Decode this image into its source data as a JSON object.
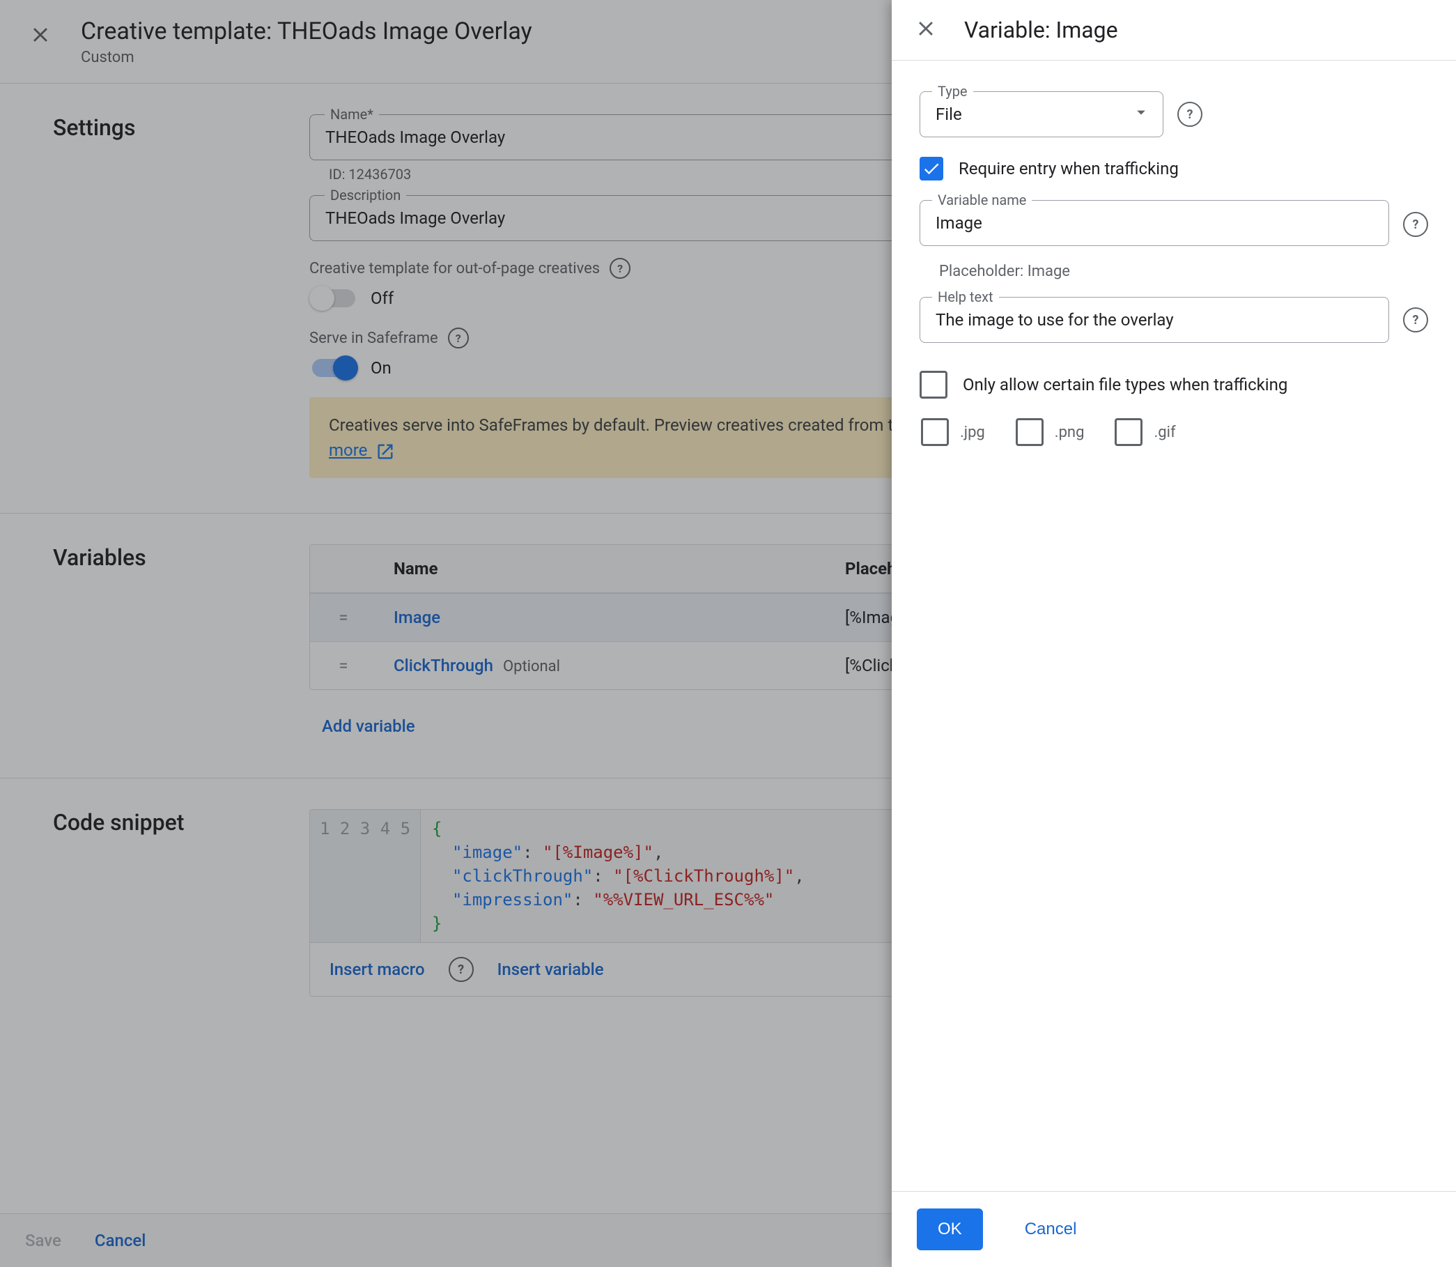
{
  "header": {
    "title": "Creative template: THEOads Image Overlay",
    "subtitle": "Custom"
  },
  "settings": {
    "section_label": "Settings",
    "name_label": "Name*",
    "name_value": "THEOads Image Overlay",
    "id_text": "ID: 12436703",
    "desc_label": "Description",
    "desc_value": "THEOads Image Overlay",
    "out_of_page_label": "Creative template for out-of-page creatives",
    "out_of_page_state": "Off",
    "safeframe_label": "Serve in Safeframe",
    "safeframe_state": "On",
    "info_text": "Creatives serve into SafeFrames by default. Preview creatives created from this template to ensure they're compatible with SafeFrames. ",
    "info_link": "Learn more"
  },
  "variables": {
    "section_label": "Variables",
    "col_name": "Name",
    "col_placeholder": "Placeholder",
    "rows": [
      {
        "name": "Image",
        "optional": "",
        "placeholder": "[%Image%]"
      },
      {
        "name": "ClickThrough",
        "optional": "Optional",
        "placeholder": "[%ClickThrough%]"
      }
    ],
    "add_label": "Add variable"
  },
  "code": {
    "section_label": "Code snippet",
    "line_count": 5,
    "kv": [
      {
        "key": "\"image\"",
        "val": "\"[%Image%]\"",
        "comma": ","
      },
      {
        "key": "\"clickThrough\"",
        "val": "\"[%ClickThrough%]\"",
        "comma": ","
      },
      {
        "key": "\"impression\"",
        "val": "\"%%VIEW_URL_ESC%%\"",
        "comma": ""
      }
    ],
    "action_macro": "Insert macro",
    "action_variable": "Insert variable"
  },
  "footer": {
    "save": "Save",
    "cancel": "Cancel"
  },
  "panel": {
    "title": "Variable: Image",
    "type_label": "Type",
    "type_value": "File",
    "require_label": "Require entry when trafficking",
    "varname_label": "Variable name",
    "varname_value": "Image",
    "varname_sub": "Placeholder: Image",
    "help_label": "Help text",
    "help_value": "The image to use for the overlay",
    "only_allow_label": "Only allow certain file types when trafficking",
    "filetypes": {
      "jpg": ".jpg",
      "png": ".png",
      "gif": ".gif"
    },
    "ok": "OK",
    "cancel": "Cancel"
  }
}
